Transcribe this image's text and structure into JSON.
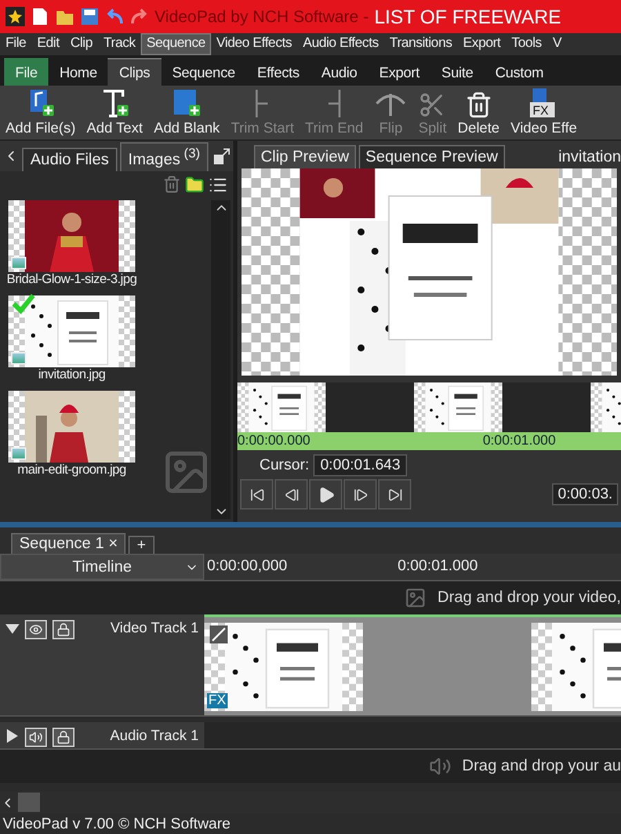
{
  "title_bar": {
    "app": "VideoPad by NCH Software -",
    "document": "LIST OF FREEWARE"
  },
  "menu": [
    {
      "label": "File",
      "selected": false
    },
    {
      "label": "Edit",
      "selected": false
    },
    {
      "label": "Clip",
      "selected": false
    },
    {
      "label": "Track",
      "selected": false
    },
    {
      "label": "Sequence",
      "selected": true
    },
    {
      "label": "Video Effects",
      "selected": false
    },
    {
      "label": "Audio Effects",
      "selected": false
    },
    {
      "label": "Transitions",
      "selected": false
    },
    {
      "label": "Export",
      "selected": false
    },
    {
      "label": "Tools",
      "selected": false
    },
    {
      "label": "V",
      "selected": false
    }
  ],
  "ribbon_tabs": [
    {
      "label": "File",
      "kind": "file",
      "selected": false
    },
    {
      "label": "Home",
      "kind": "tab",
      "selected": false
    },
    {
      "label": "Clips",
      "kind": "tab",
      "selected": true
    },
    {
      "label": "Sequence",
      "kind": "tab",
      "selected": false
    },
    {
      "label": "Effects",
      "kind": "tab",
      "selected": false
    },
    {
      "label": "Audio",
      "kind": "tab",
      "selected": false
    },
    {
      "label": "Export",
      "kind": "tab",
      "selected": false
    },
    {
      "label": "Suite",
      "kind": "tab",
      "selected": false
    },
    {
      "label": "Custom",
      "kind": "tab",
      "selected": false
    }
  ],
  "toolbar": [
    {
      "label": "Add File(s)",
      "kind": "addfile",
      "disabled": false
    },
    {
      "label": "Add Text",
      "kind": "addtext",
      "disabled": false
    },
    {
      "label": "Add Blank",
      "kind": "addblank",
      "disabled": false
    },
    {
      "label": "Trim Start",
      "kind": "trimstart",
      "disabled": true
    },
    {
      "label": "Trim End",
      "kind": "trimend",
      "disabled": true
    },
    {
      "label": "Flip",
      "kind": "flip",
      "disabled": true
    },
    {
      "label": "Split",
      "kind": "split",
      "disabled": true
    },
    {
      "label": "Delete",
      "kind": "delete",
      "disabled": false
    },
    {
      "label": "Video Effe",
      "kind": "fx",
      "badge": "FX",
      "disabled": false
    }
  ],
  "bin": {
    "tabs": [
      {
        "label": "Audio Files",
        "selected": false
      },
      {
        "label": "Images",
        "count": "(3)",
        "selected": true
      }
    ],
    "files": [
      {
        "name": "Bridal-Glow-1-size-3.jpg",
        "checked": false
      },
      {
        "name": "invitation.jpg",
        "checked": true
      },
      {
        "name": "main-edit-groom.jpg",
        "checked": false
      }
    ]
  },
  "preview": {
    "tabs": [
      {
        "label": "Clip Preview",
        "selected": true
      },
      {
        "label": "Sequence Preview",
        "selected": false
      }
    ],
    "clip_name": "invitation",
    "ruler": [
      "0:00:00.000",
      "0:00:01.000"
    ],
    "cursor_label": "Cursor:",
    "cursor": "0:00:01.643",
    "duration": "0:00:03."
  },
  "sequence": {
    "tabs": [
      {
        "label": "Sequence 1",
        "close": "×",
        "selected": true
      }
    ],
    "add": "+",
    "timeline_label": "Timeline",
    "ruler": [
      "0:00:00,000",
      "0:00:01.000"
    ],
    "video_hint": "Drag and drop your video,",
    "tracks": [
      {
        "kind": "video",
        "name": "Video Track 1",
        "expanded": true,
        "fx": "FX"
      },
      {
        "kind": "audio",
        "name": "Audio Track 1",
        "expanded": false
      }
    ],
    "audio_hint": "Drag and drop your au"
  },
  "status_bar": "VideoPad v 7.00 © NCH Software"
}
